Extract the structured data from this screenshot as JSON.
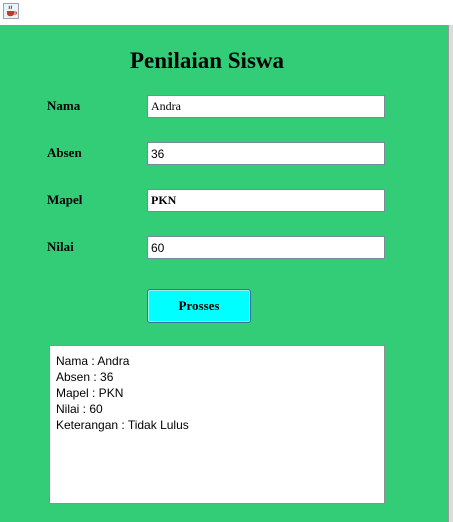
{
  "window": {
    "icon": "java-cup-icon"
  },
  "form": {
    "title": "Penilaian Siswa",
    "fields": [
      {
        "label": "Nama",
        "value": "Andra"
      },
      {
        "label": "Absen",
        "value": "36"
      },
      {
        "label": "Mapel",
        "value": "PKN"
      },
      {
        "label": "Nilai",
        "value": "60"
      }
    ],
    "button_label": "Prosses"
  },
  "output": {
    "lines": [
      "Nama : Andra",
      "Absen : 36",
      "Mapel : PKN",
      "Nilai : 60",
      "Keterangan : Tidak Lulus"
    ]
  },
  "colors": {
    "panel_background": "#33cc77",
    "button_background": "#00ffff"
  }
}
